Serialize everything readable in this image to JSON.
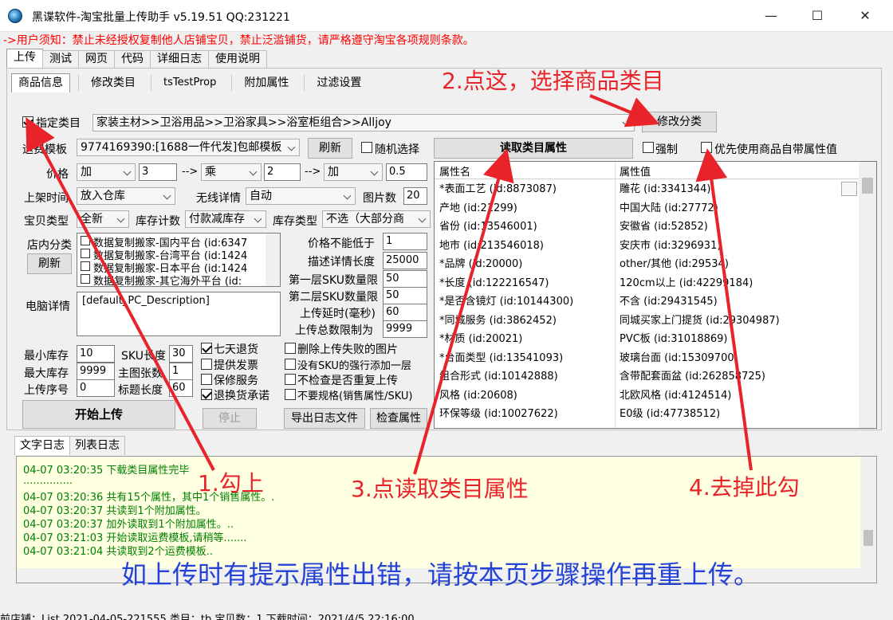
{
  "window": {
    "title": "黑谍软件-淘宝批量上传助手 v5.19.51 QQ:231221",
    "minimize": "—",
    "maximize": "☐",
    "close": "✕"
  },
  "notice": "->用户须知：禁止未经授权复制他人店铺宝贝，禁止泛滥铺货，请严格遵守淘宝各项规则条款。",
  "main_tabs": [
    "上传",
    "测试",
    "网页",
    "代码",
    "详细日志",
    "使用说明"
  ],
  "sub_tabs": [
    "商品信息",
    "修改类目",
    "tsTestProp",
    "附加属性",
    "过滤设置"
  ],
  "category": {
    "checkbox_label": "指定类目",
    "checked": true,
    "value": "家装主材>>卫浴用品>>卫浴家具>>浴室柜组合>>Alljoy",
    "modify_button": "修改分类"
  },
  "shipping": {
    "label": "运费模板",
    "value": "9774169390:[1688一件代发]包邮模板",
    "refresh": "刷新",
    "random_label": "随机选择"
  },
  "price": {
    "label": "价格",
    "op1": "加",
    "v1": "3",
    "arrow1": "-->",
    "op2": "乘",
    "v2": "2",
    "arrow2": "-->",
    "op3": "加",
    "v3": "0.5"
  },
  "listing_time": {
    "label": "上架时间",
    "value": "放入仓库"
  },
  "wireless": {
    "label": "无线详情",
    "value": "自动"
  },
  "image_count": {
    "label": "图片数",
    "value": "20"
  },
  "item_type": {
    "label": "宝贝类型",
    "value": "全新"
  },
  "stock_count": {
    "label": "库存计数",
    "value": "付款减库存"
  },
  "stock_type": {
    "label": "库存类型",
    "value": "不选（大部分商"
  },
  "shop_category": {
    "label": "店内分类",
    "refresh": "刷新",
    "items": [
      "数据复制搬家-国内平台 (id:6347",
      "数据复制搬家-台湾平台 (id:1424",
      "数据复制搬家-日本平台 (id:1424",
      "数据复制搬家-其它海外平台 (id:"
    ]
  },
  "limits": [
    {
      "label": "价格不能低于",
      "value": "1"
    },
    {
      "label": "描述详情长度",
      "value": "25000"
    },
    {
      "label": "第一层SKU数量限",
      "value": "50"
    },
    {
      "label": "第二层SKU数量限",
      "value": "50"
    },
    {
      "label": "上传延时(毫秒)",
      "value": "60"
    },
    {
      "label": "上传总数限制为",
      "value": "9999"
    }
  ],
  "pc_detail": {
    "label": "电脑详情",
    "value": "[default_PC_Description]"
  },
  "stock_min": {
    "label": "最小库存",
    "value": "10"
  },
  "stock_max": {
    "label": "最大库存",
    "value": "9999"
  },
  "upload_seq": {
    "label": "上传序号",
    "value": "0"
  },
  "sku_len": {
    "label": "SKU长度",
    "value": "30"
  },
  "main_img": {
    "label": "主图张数",
    "value": "1"
  },
  "title_len": {
    "label": "标题长度",
    "value": "60"
  },
  "service_checks": [
    {
      "label": "七天退货",
      "checked": true
    },
    {
      "label": "提供发票",
      "checked": false
    },
    {
      "label": "保修服务",
      "checked": false
    },
    {
      "label": "退换货承诺",
      "checked": true
    }
  ],
  "option_checks": [
    {
      "label": "删除上传失败的图片",
      "checked": false
    },
    {
      "label": "没有SKU的强行添加一层",
      "checked": false
    },
    {
      "label": "不检查是否重复上传",
      "checked": false
    },
    {
      "label": "不要规格(销售属性/SKU)",
      "checked": false
    }
  ],
  "buttons": {
    "start": "开始上传",
    "stop": "停止",
    "export_log": "导出日志文件",
    "check_props": "检查属性",
    "read_props": "读取类目属性"
  },
  "force": {
    "label": "强制",
    "checked": false
  },
  "prefer_own": {
    "label": "优先使用商品自带属性值",
    "checked": false
  },
  "prop_grid": {
    "headers": [
      "属性名",
      "属性值"
    ],
    "rows": [
      [
        "*表面工艺 (id:8873087)",
        "雕花 (id:3341344)"
      ],
      [
        "产地 (id:21299)",
        "中国大陆 (id:27772)"
      ],
      [
        "省份 (id:13546001)",
        "安徽省 (id:52852)"
      ],
      [
        "地市 (id:213546018)",
        "安庆市 (id:3296931)"
      ],
      [
        "*品牌 (id:20000)",
        "other/其他 (id:29534)"
      ],
      [
        "*长度 (id:122216547)",
        "120cm以上 (id:42299184)"
      ],
      [
        "*是否含镜灯 (id:10144300)",
        "不含 (id:29431545)"
      ],
      [
        "*同城服务 (id:3862452)",
        "同城买家上门提货 (id:29304987)"
      ],
      [
        "*材质 (id:20021)",
        "PVC板 (id:31018869)"
      ],
      [
        "*台面类型 (id:13541093)",
        "玻璃台面 (id:15309700)"
      ],
      [
        "组合形式 (id:10142888)",
        "含带配套面盆 (id:262858725)"
      ],
      [
        "风格 (id:20608)",
        "北欧风格 (id:4124514)"
      ],
      [
        "环保等级 (id:10027622)",
        "E0级 (id:47738512)"
      ]
    ]
  },
  "log_tabs": [
    "文字日志",
    "列表日志"
  ],
  "log_lines": [
    "04-07 03:20:35  下载类目属性完毕",
    "...............",
    "04-07 03:20:36  共有15个属性，其中1个销售属性。.",
    "04-07 03:20:37  共读到1个附加属性。",
    "04-07 03:20:37  加外读取到1个附加属性。..",
    "04-07 03:21:03  开始读取运费模板,请稍等.......",
    "04-07 03:21:04  共读取到2个运费模板.."
  ],
  "statusbar": "前店铺：List 2021-04-05-221555    类目：tb    宝贝数：1    下载时间：2021/4/5 22:16:00",
  "annotations": {
    "a1": "1.勾上",
    "a2": "2.点这，选择商品类目",
    "a3": "3.点读取类目属性",
    "a4": "4.去掉此勾",
    "bottom": "如上传时有提示属性出错，请按本页步骤操作再重上传。",
    "red": "#e8232a",
    "blue": "#2443d6"
  }
}
